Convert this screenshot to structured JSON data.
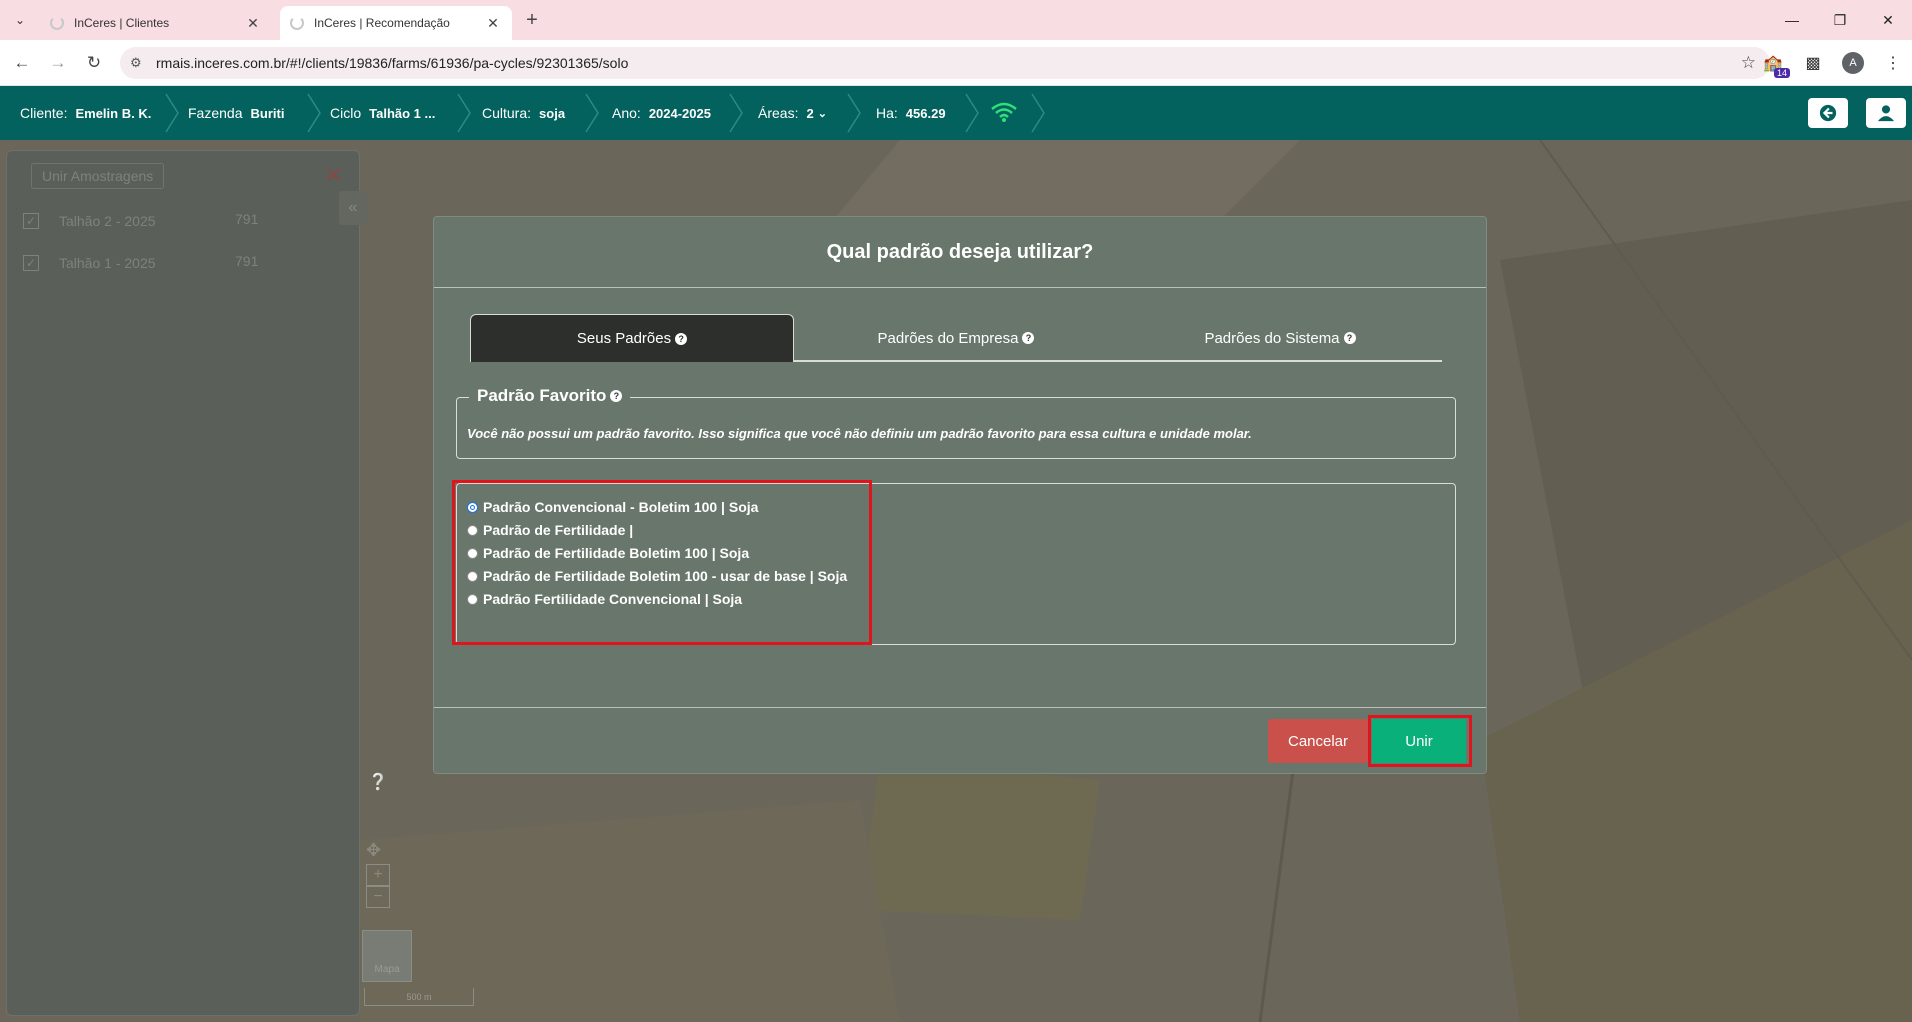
{
  "browser": {
    "tabs": [
      {
        "title": "InCeres | Clientes",
        "active": false
      },
      {
        "title": "InCeres | Recomendação",
        "active": true
      }
    ],
    "url": "rmais.inceres.com.br/#!/clients/19836/farms/61936/pa-cycles/92301365/solo",
    "extension_badge": "14",
    "profile_initial": "A"
  },
  "header": {
    "cliente_label": "Cliente:",
    "cliente_value": "Emelin B. K.",
    "fazenda_label": "Fazenda",
    "fazenda_value": "Buriti",
    "ciclo_label": "Ciclo",
    "ciclo_value": "Talhão 1 ...",
    "cultura_label": "Cultura:",
    "cultura_value": "soja",
    "ano_label": "Ano:",
    "ano_value": "2024-2025",
    "areas_label": "Áreas:",
    "areas_value": "2",
    "ha_label": "Ha:",
    "ha_value": "456.29",
    "accent_color": "#03625d"
  },
  "left_panel": {
    "unir_label": "Unir Amostragens",
    "items": [
      {
        "name": "Talhão 2 - 2025",
        "value": "791",
        "checked": true
      },
      {
        "name": "Talhão 1 - 2025",
        "value": "791",
        "checked": true
      }
    ]
  },
  "map": {
    "map_type_label": "Mapa",
    "scale_label": "500 m"
  },
  "modal": {
    "title": "Qual padrão deseja utilizar?",
    "tabs": [
      {
        "label": "Seus Padrões",
        "active": true
      },
      {
        "label": "Padrões do Empresa",
        "active": false
      },
      {
        "label": "Padrões do Sistema",
        "active": false
      }
    ],
    "favorite_legend": "Padrão Favorito",
    "favorite_text": "Você não possui um padrão favorito. Isso significa que você não definiu um padrão favorito para essa cultura e unidade molar.",
    "options": [
      {
        "label": "Padrão Convencional - Boletim 100 | Soja",
        "selected": true
      },
      {
        "label": "Padrão de Fertilidade |",
        "selected": false
      },
      {
        "label": "Padrão de Fertilidade Boletim 100 | Soja",
        "selected": false
      },
      {
        "label": "Padrão de Fertilidade Boletim 100 - usar de base | Soja",
        "selected": false
      },
      {
        "label": "Padrão Fertilidade Convencional | Soja",
        "selected": false
      }
    ],
    "cancel_label": "Cancelar",
    "confirm_label": "Unir",
    "cancel_color": "#c9504b",
    "confirm_color": "#09b07a"
  }
}
